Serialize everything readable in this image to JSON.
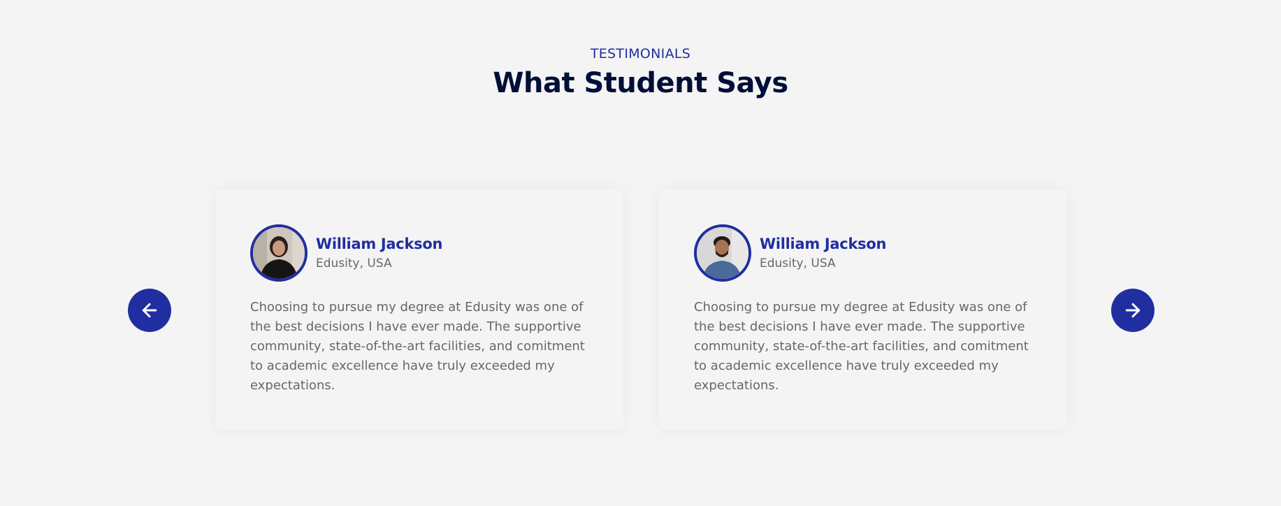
{
  "header": {
    "eyebrow": "TESTIMONIALS",
    "title": "What Student Says"
  },
  "slider": {
    "prev_icon": "arrow-left-icon",
    "next_icon": "arrow-right-icon",
    "accent_color": "#212ea0"
  },
  "testimonials": [
    {
      "name": "William Jackson",
      "location": "Edusity, USA",
      "avatar": "female-student-photo",
      "quote": "Choosing to pursue my degree at Edusity was one of the best decisions I have ever made. The supportive community, state-of-the-art facilities, and comitment to academic excellence have truly exceeded my expectations."
    },
    {
      "name": "William Jackson",
      "location": "Edusity, USA",
      "avatar": "male-student-photo",
      "quote": "Choosing to pursue my degree at Edusity was one of the best decisions I have ever made. The supportive community, state-of-the-art facilities, and comitment to academic excellence have truly exceeded my expectations."
    }
  ]
}
